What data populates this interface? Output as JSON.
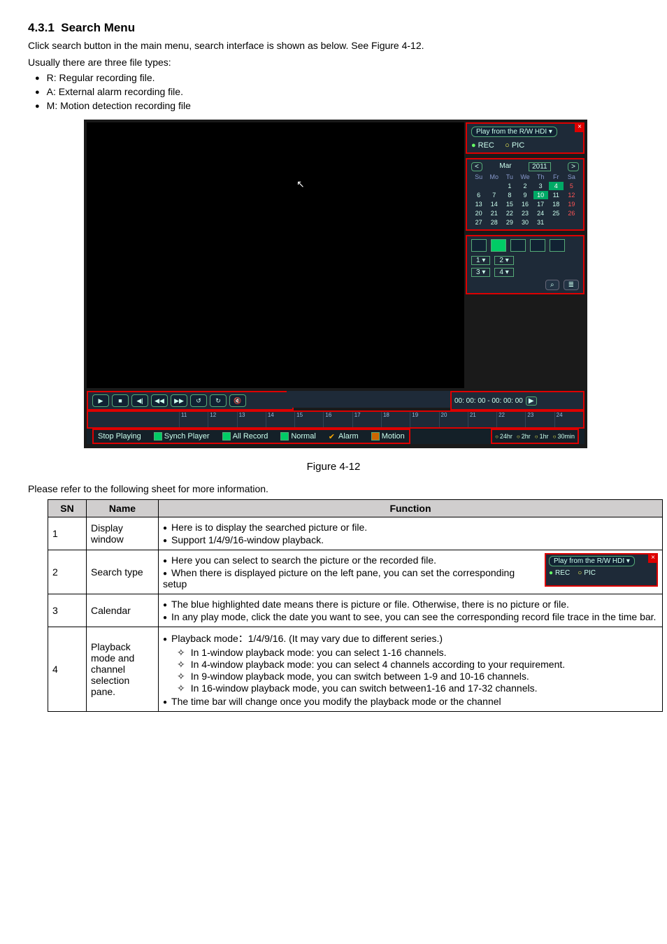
{
  "section": {
    "number": "4.3.1",
    "title": "Search Menu"
  },
  "intro_p1": "Click search button in the main menu, search interface is shown as below. See Figure 4-12.",
  "intro_p2": "Usually there are three file types:",
  "file_types": [
    "R: Regular recording file.",
    "A: External alarm recording file.",
    "M: Motion detection recording file"
  ],
  "screenshot": {
    "top_panel": {
      "dropdown": "Play from the R/W HDI ▾",
      "rec": "REC",
      "pic": "PIC"
    },
    "calendar": {
      "month": "Mar",
      "year": "2011",
      "dows": [
        "Su",
        "Mo",
        "Tu",
        "We",
        "Th",
        "Fr",
        "Sa"
      ],
      "days": [
        "",
        "",
        "1",
        "2",
        "3",
        "4",
        "5",
        "6",
        "7",
        "8",
        "9",
        "10",
        "11",
        "12",
        "13",
        "14",
        "15",
        "16",
        "17",
        "18",
        "19",
        "20",
        "21",
        "22",
        "23",
        "24",
        "25",
        "26",
        "27",
        "28",
        "29",
        "30",
        "31",
        "",
        ""
      ]
    },
    "channels": [
      "1 ▾",
      "2 ▾",
      "3 ▾",
      "4 ▾"
    ],
    "search_btn": "⌕",
    "list_btn": "≣",
    "time_readout": "00: 00: 00   - 00: 00: 00",
    "timeline_ticks": [
      "11",
      "12",
      "13",
      "14",
      "15",
      "16",
      "17",
      "18",
      "19",
      "20",
      "21",
      "22",
      "23",
      "24"
    ],
    "status": {
      "stop": "Stop Playing",
      "synch": "Synch Player",
      "allrec": "All Record",
      "normal": "Normal",
      "alarm": "Alarm",
      "motion": "Motion",
      "zoom": [
        "24hr",
        "2hr",
        "1hr",
        "30min"
      ]
    }
  },
  "figure_caption": "Figure 4-12",
  "table_intro": "Please refer to the following sheet for more information.",
  "table": {
    "headers": {
      "sn": "SN",
      "name": "Name",
      "fn": "Function"
    },
    "rows": [
      {
        "sn": "1",
        "name": "Display window",
        "fn_lines": [
          "Here is to display the searched picture or file.",
          "Support 1/4/9/16-window playback."
        ]
      },
      {
        "sn": "2",
        "name": "Search type",
        "fn_lines": [
          "Here you can select to search the picture or the recorded file.",
          "When there is displayed picture on the left pane, you can set the corresponding setup"
        ],
        "mini": {
          "dropdown": "Play from the R/W HDI ▾",
          "rec": "REC",
          "pic": "PIC"
        }
      },
      {
        "sn": "3",
        "name": "Calendar",
        "fn_lines": [
          "The blue highlighted date means there is picture or file. Otherwise, there is no picture or file.",
          "In any play mode, click the date you want to see, you can see the corresponding record file trace in the time bar."
        ]
      },
      {
        "sn": "4",
        "name": "Playback mode and channel selection pane.",
        "fn_first": "Playback mode：1/4/9/16. (It may vary due to different series.)",
        "fn_subs": [
          "In 1-window playback mode: you can select 1-16 channels.",
          "In 4-window playback mode: you can select 4 channels according to your requirement.",
          "In 9-window playback mode, you can switch between 1-9 and 10-16 channels.",
          "In 16-window playback mode, you can switch between1-16 and 17-32 channels."
        ],
        "fn_last": "The time bar will change once you modify the playback mode or the channel"
      }
    ]
  }
}
